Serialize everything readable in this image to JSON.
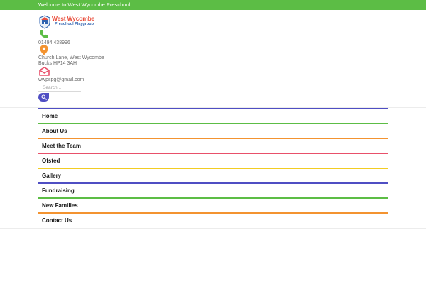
{
  "topbar": {
    "welcome_text": "Welcome to West Wycombe Preschool",
    "color": "#5cbd45"
  },
  "logo": {
    "line1": "West Wycombe",
    "line2": "Preschool Playgroup"
  },
  "contact": {
    "phone": "01494 438996",
    "address_line1": "Church Lane, West Wycombe",
    "address_line2": "Bucks HP14 3AH",
    "email": "wwpspg@gmail.com",
    "phone_icon": "phone-icon",
    "location_icon": "map-pin-icon",
    "email_icon": "envelope-icon"
  },
  "search": {
    "placeholder": "Search...",
    "value": "",
    "button_icon": "search-icon",
    "button_color": "#4f4ec3"
  },
  "nav": {
    "items": [
      {
        "label": "Home",
        "color": "#4f4ec3"
      },
      {
        "label": "About Us",
        "color": "#5cbd45"
      },
      {
        "label": "Meet the Team",
        "color": "#f39330"
      },
      {
        "label": "Ofsted",
        "color": "#e8506a"
      },
      {
        "label": "Gallery",
        "color": "#f2cc23"
      },
      {
        "label": "Fundraising",
        "color": "#4f4ec3"
      },
      {
        "label": "New Families",
        "color": "#5cbd45"
      },
      {
        "label": "Contact Us",
        "color": "#f39330"
      }
    ]
  }
}
